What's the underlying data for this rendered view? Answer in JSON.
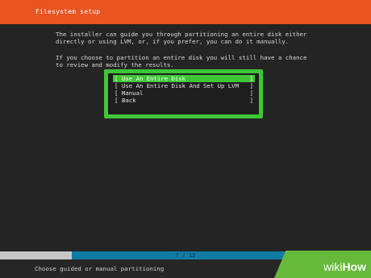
{
  "header": {
    "title": "Filesystem setup"
  },
  "intro": {
    "line1": "The installer can guide you through partitioning an entire disk either",
    "line2": "directly or using LVM, or, if you prefer, you can do it manually.",
    "line3": "If you choose to partition an entire disk you will still have a chance",
    "line4": "to review and modify the results."
  },
  "menu": {
    "items": [
      {
        "label": "Use An Entire Disk",
        "selected": true
      },
      {
        "label": "Use An Entire Disk And Set Up LVM",
        "selected": false
      },
      {
        "label": "Manual",
        "selected": false
      },
      {
        "label": "Back",
        "selected": false
      }
    ]
  },
  "progress": {
    "text": "7 / 12",
    "current": 7,
    "total": 12
  },
  "status": {
    "text": "Choose guided or manual partitioning"
  },
  "watermark": {
    "wiki": "wiki",
    "how": "How"
  },
  "colors": {
    "header": "#e95420",
    "highlight": "#3ec637",
    "progress_fill": "#0f7ca6",
    "background": "#242424"
  }
}
